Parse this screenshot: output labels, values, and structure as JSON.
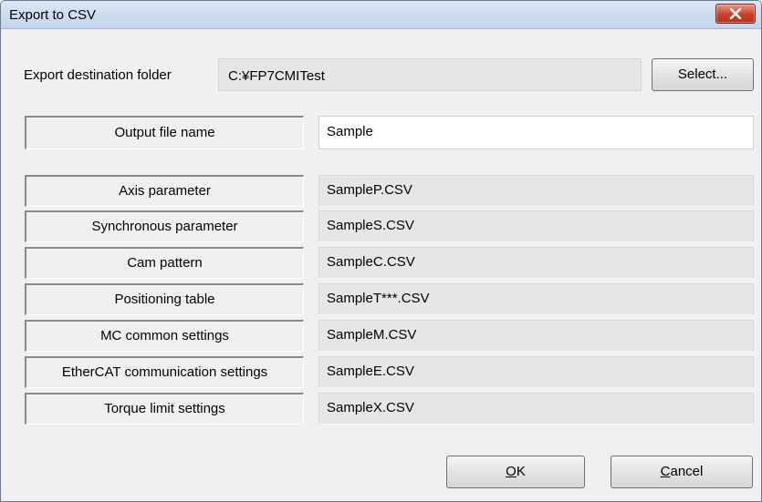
{
  "window": {
    "title": "Export to CSV"
  },
  "destination": {
    "label": "Export destination folder",
    "path": "C:¥FP7CMITest",
    "select_label": "Select..."
  },
  "output": {
    "label": "Output file name",
    "value": "Sample"
  },
  "rows": [
    {
      "label": "Axis parameter",
      "value": "SampleP.CSV"
    },
    {
      "label": "Synchronous parameter",
      "value": "SampleS.CSV"
    },
    {
      "label": "Cam pattern",
      "value": "SampleC.CSV"
    },
    {
      "label": "Positioning table",
      "value": "SampleT***.CSV"
    },
    {
      "label": "MC common settings",
      "value": "SampleM.CSV"
    },
    {
      "label": "EtherCAT communication settings",
      "value": "SampleE.CSV"
    },
    {
      "label": "Torque limit settings",
      "value": "SampleX.CSV"
    }
  ],
  "buttons": {
    "ok": {
      "mnemonic": "O",
      "rest": "K"
    },
    "cancel": {
      "mnemonic": "C",
      "rest": "ancel"
    }
  },
  "icons": {
    "close": "close-icon"
  },
  "colors": {
    "close_button": "#c7402c",
    "titlebar": "#c3d4ec"
  }
}
